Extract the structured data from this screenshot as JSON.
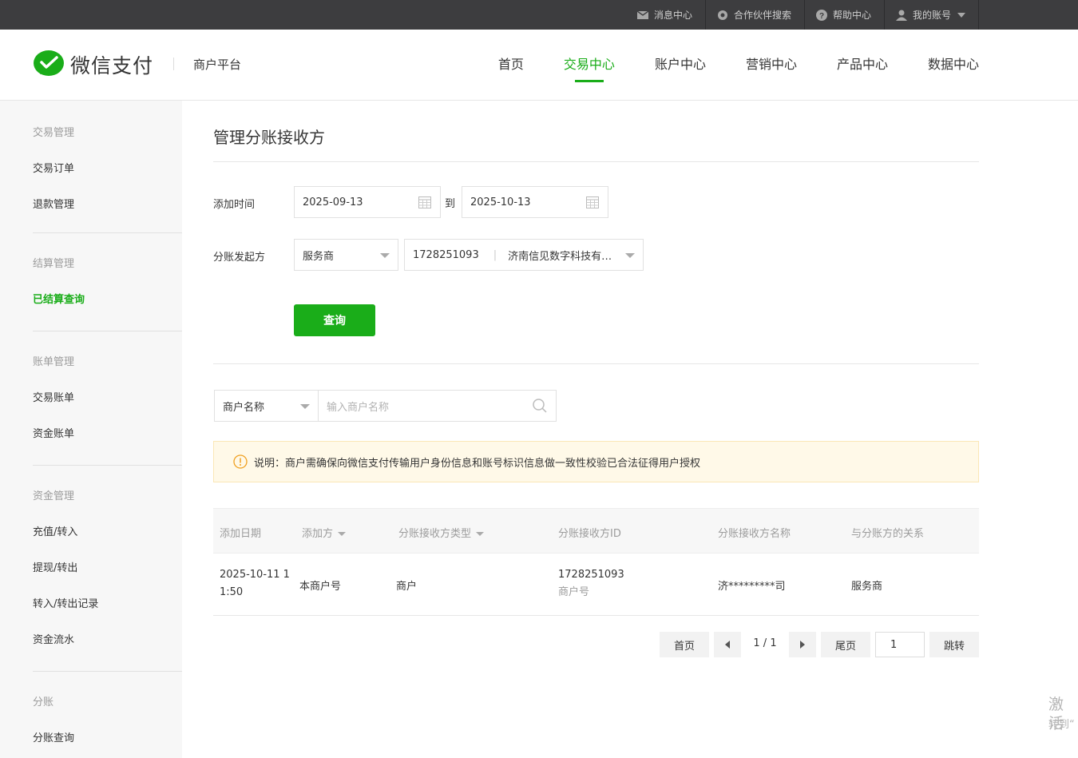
{
  "topbar": {
    "links": [
      {
        "label": "消息中心",
        "icon": "mail-icon"
      },
      {
        "label": "合作伙伴搜索",
        "icon": "partner-search-icon"
      },
      {
        "label": "帮助中心",
        "icon": "help-icon"
      },
      {
        "label": "我的账号",
        "icon": "user-icon"
      }
    ]
  },
  "header": {
    "brand": "微信支付",
    "platform": "商户平台",
    "nav": [
      "首页",
      "交易中心",
      "账户中心",
      "营销中心",
      "产品中心",
      "数据中心"
    ],
    "active_nav": "交易中心"
  },
  "sidebar": {
    "groups": [
      {
        "title": "交易管理",
        "items": [
          "交易订单",
          "退款管理"
        ]
      },
      {
        "title": "结算管理",
        "items": [
          "已结算查询"
        ]
      },
      {
        "title": "账单管理",
        "items": [
          "交易账单",
          "资金账单"
        ]
      },
      {
        "title": "资金管理",
        "items": [
          "充值/转入",
          "提现/转出",
          "转入/转出记录",
          "资金流水"
        ]
      },
      {
        "title": "分账",
        "items": [
          "分账查询"
        ]
      }
    ],
    "active_item": "已结算查询"
  },
  "main": {
    "title": "管理分账接收方",
    "form": {
      "time_label": "添加时间",
      "start_date": "2025-09-13",
      "to_label": "到",
      "end_date": "2025-10-13",
      "initiator_label": "分账发起方",
      "initiator_type": "服务商",
      "initiator_id": "1728251093",
      "initiator_name": "济南信见数字科技有…",
      "query_button": "查询"
    },
    "filter": {
      "select_value": "商户名称",
      "search_placeholder": "输入商户名称"
    },
    "notice": "说明：商户需确保向微信支付传输用户身份信息和账号标识信息做一致性校验已合法征得用户授权",
    "table": {
      "headers": [
        "添加日期",
        "添加方",
        "分账接收方类型",
        "分账接收方ID",
        "分账接收方名称",
        "与分账方的关系"
      ],
      "rows": [
        {
          "date_line1": "2025-10-11 1",
          "date_line2": "1:50",
          "adder": "本商户号",
          "type": "商户",
          "id": "1728251093",
          "id_sub": "商户号",
          "name": "济*********司",
          "relation": "服务商"
        }
      ]
    },
    "pager": {
      "first": "首页",
      "page_info": "1 / 1",
      "last": "尾页",
      "jump_value": "1",
      "jump": "跳转"
    }
  },
  "watermark": {
    "line1": "激活",
    "line2": "转到“"
  },
  "colors": {
    "accent": "#1aad19",
    "topbar_bg": "#3d3d3f",
    "notice_bg": "#fff9e8",
    "notice_icon": "#f0a020"
  }
}
